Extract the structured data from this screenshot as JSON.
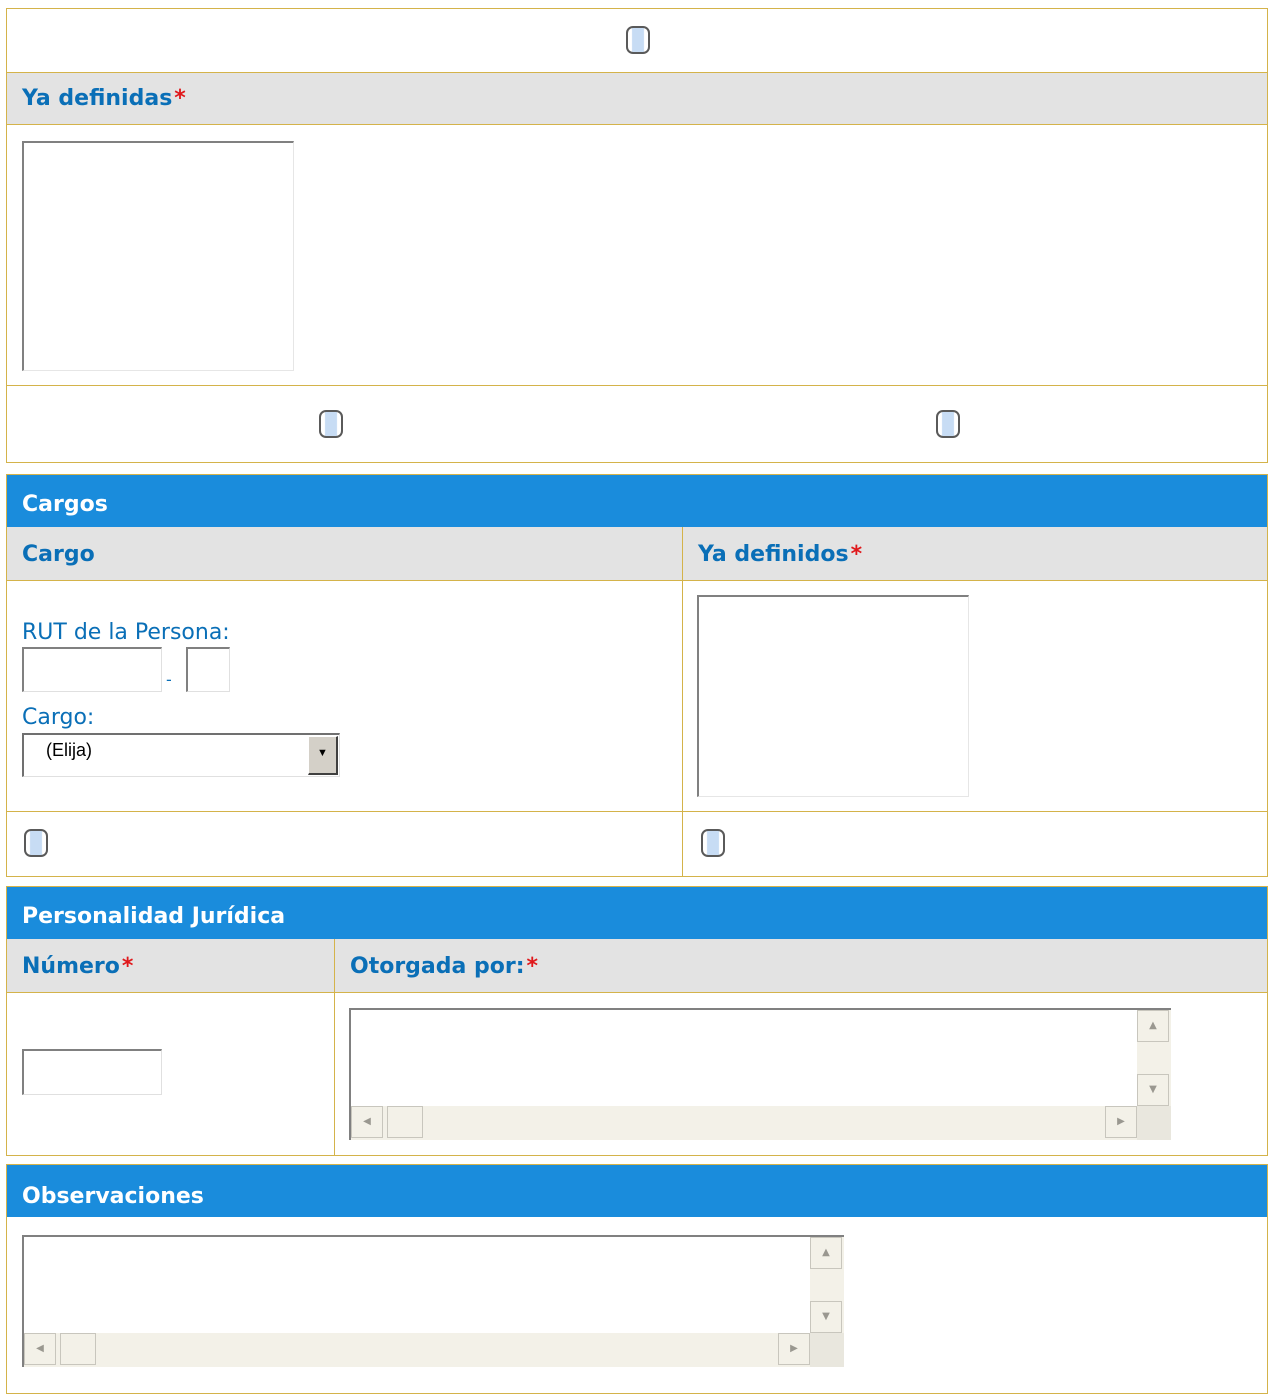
{
  "zonas": {
    "header_label": "Ya definidas",
    "required_marker": "*"
  },
  "cargos": {
    "title": "Cargos",
    "col_cargo": "Cargo",
    "col_ya_definidos": "Ya definidos",
    "required_marker": "*",
    "rut_label": "RUT de la Persona:",
    "rut_separator": "-",
    "cargo_label": "Cargo:",
    "cargo_select_value": "(Elija)"
  },
  "personalidad": {
    "title": "Personalidad Jurídica",
    "col_numero": "Número",
    "col_otorgada": "Otorgada por:",
    "required_marker": "*"
  },
  "observaciones": {
    "title": "Observaciones"
  },
  "icons": {
    "scroll_up": "▲",
    "scroll_down": "▼",
    "scroll_left": "◀",
    "scroll_right": "▶",
    "dropdown": "▼"
  },
  "colors": {
    "header_blue": "#1a8cdc",
    "label_blue": "#0a6fb7",
    "required_red": "#e0181b",
    "border_gold": "#d4b34a",
    "header_grey": "#e3e3e3"
  }
}
